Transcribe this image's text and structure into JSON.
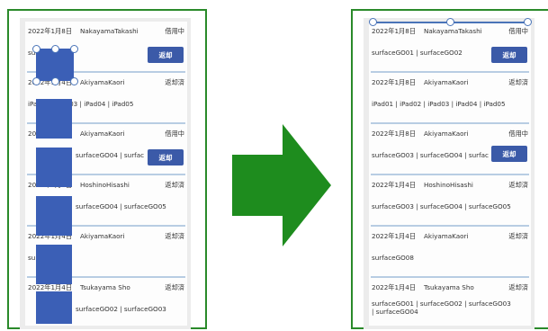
{
  "left_screen": {
    "items": [
      {
        "date": "2022年1月8日",
        "user": "NakayamaTakashi",
        "status": "借用中",
        "devices": "surfaceGO02",
        "button": "返却"
      },
      {
        "date": "2022年1月4日",
        "user": "AkiyamaKaori",
        "status": "返却済",
        "devices": "iPad02 | iPad03 | iPad04 | iPad05"
      },
      {
        "date": "2022年1月8日",
        "user": "AkiyamaKaori",
        "status": "借用中",
        "devices": "surfaceGO04 | surfac",
        "button": "返却"
      },
      {
        "date": "2022年1月4日",
        "user": "HoshinoHisashi",
        "status": "返却済",
        "devices": "surfaceGO04 | surfaceGO05"
      },
      {
        "date": "2022年1月4日",
        "user": "AkiyamaKaori",
        "status": "返却済",
        "devices": "su"
      },
      {
        "date": "2022年1月4日",
        "user": "Tsukayama Sho",
        "status": "返却済",
        "devices": "surfaceGO02 | surfaceGO03"
      }
    ]
  },
  "right_screen": {
    "items": [
      {
        "date": "2022年1月8日",
        "user": "NakayamaTakashi",
        "status": "借用中",
        "devices": "surfaceGO01 | surfaceGO02",
        "button": "返却"
      },
      {
        "date": "2022年1月8日",
        "user": "AkiyamaKaori",
        "status": "返却済",
        "devices": "iPad01 | iPad02 | iPad03 | iPad04 | iPad05"
      },
      {
        "date": "2022年1月8日",
        "user": "AkiyamaKaori",
        "status": "借用中",
        "devices": "surfaceGO03 | surfaceGO04 | surfac",
        "button": "返却"
      },
      {
        "date": "2022年1月4日",
        "user": "HoshinoHisashi",
        "status": "返却済",
        "devices": "surfaceGO03 | surfaceGO04 | surfaceGO05"
      },
      {
        "date": "2022年1月4日",
        "user": "AkiyamaKaori",
        "status": "返却済",
        "devices": "surfaceGO08"
      },
      {
        "date": "2022年1月4日",
        "user": "Tsukayama Sho",
        "status": "返却済",
        "devices": "surfaceGO01 | surfaceGO02 | surfaceGO03",
        "devices_line2": "| surfaceGO04"
      }
    ]
  },
  "colors": {
    "frame": "#2a8a2a",
    "arrow": "#1e8c1e",
    "button": "#3b5aa8",
    "mask": "#3b5fb6",
    "separator": "#b8cde3"
  }
}
